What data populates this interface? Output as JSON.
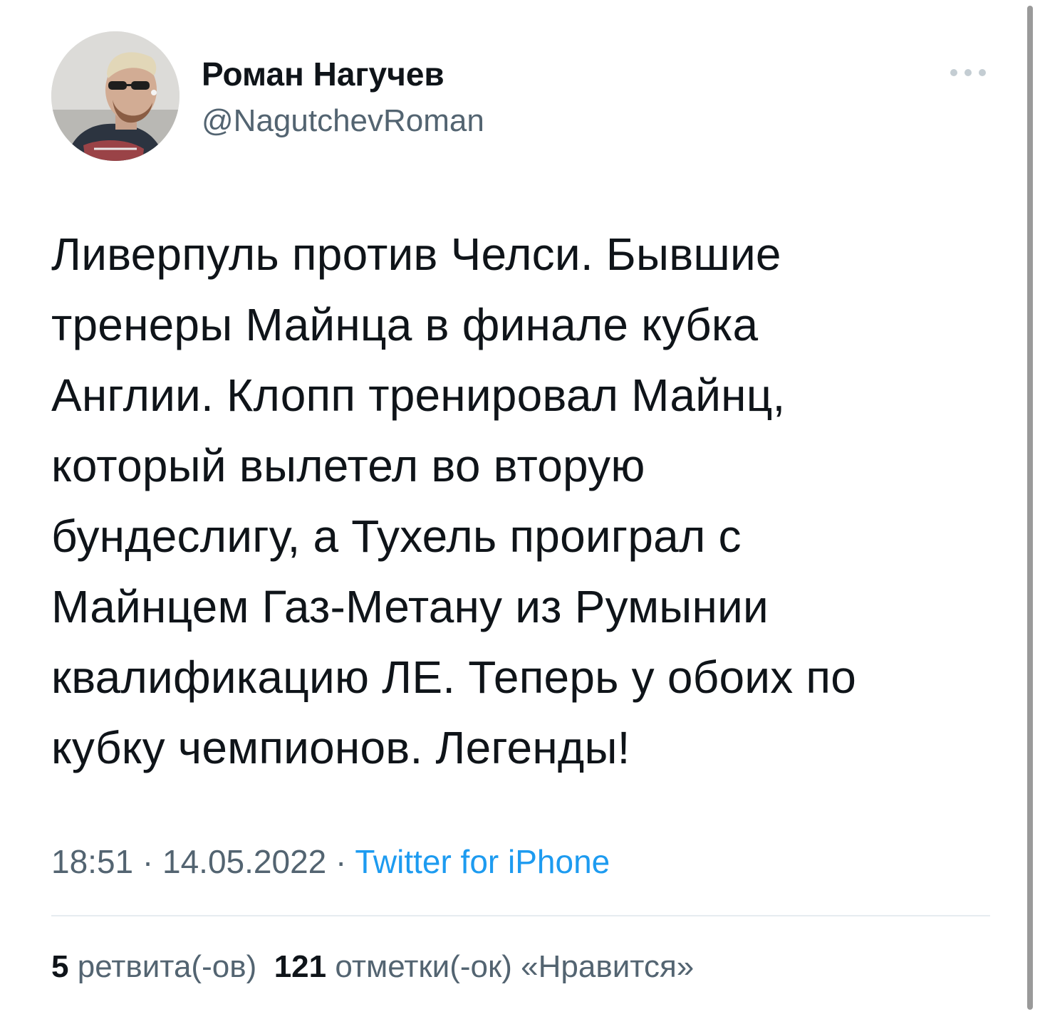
{
  "author": {
    "name": "Роман Нагучев",
    "handle": "@NagutchevRoman"
  },
  "tweet": {
    "text": "Ливерпуль против Челси. Бывшие\nтренеры Майнца в финале кубка\nАнглии. Клопп тренировал Майнц,\nкоторый вылетел во вторую\nбундеслигу, а Тухель проиграл с\nМайнцем Газ-Метану из Румынии\nквалификацию ЛЕ. Теперь у обоих по\nкубку чемпионов. Легенды!"
  },
  "meta": {
    "time": "18:51",
    "separator_1": " · ",
    "date": "14.05.2022",
    "separator_2": " · ",
    "source": "Twitter for iPhone"
  },
  "stats": {
    "retweets_count": "5",
    "retweets_label": "ретвита(-ов)",
    "likes_count": "121",
    "likes_label": "отметки(-ок) «Нравится»"
  },
  "icons": {
    "more": "more-horizontal-icon"
  },
  "colors": {
    "text_primary": "#0f1419",
    "text_secondary": "#536471",
    "link": "#1d9bf0",
    "divider": "#e6ecf0"
  }
}
